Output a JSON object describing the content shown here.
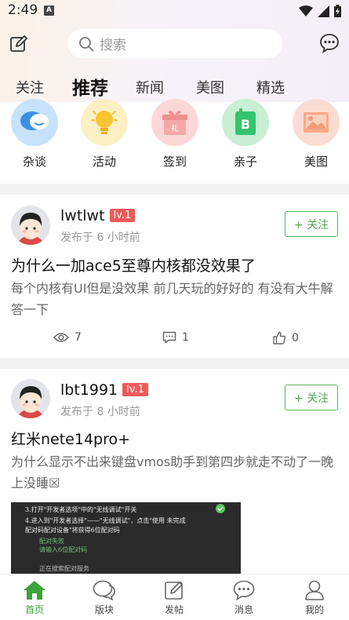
{
  "status_bar": {
    "time": "2:49",
    "notif_letter": "A"
  },
  "header": {
    "search_placeholder": "搜索",
    "tabs": [
      {
        "label": "关注"
      },
      {
        "label": "推荐"
      },
      {
        "label": "新闻"
      },
      {
        "label": "美图"
      },
      {
        "label": "精选"
      }
    ],
    "active_tab": "推荐"
  },
  "categories": [
    {
      "label": "杂谈",
      "icon": "chat-bubble-icon",
      "color": "#c6e3fb"
    },
    {
      "label": "活动",
      "icon": "lightbulb-icon",
      "color": "#fbf0c4"
    },
    {
      "label": "签到",
      "icon": "gift-icon",
      "color": "#fbd7d7"
    },
    {
      "label": "亲子",
      "icon": "book-icon",
      "color": "#c8efd3"
    },
    {
      "label": "美图",
      "icon": "picture-icon",
      "color": "#fbdcd2"
    }
  ],
  "posts": [
    {
      "username": "lwtlwt",
      "level": "lv.1",
      "time": "发布于 6 小时前",
      "follow_label": "+ 关注",
      "title": "为什么一加ace5至尊内核都没效果了",
      "body": "每个内核有UI但是没效果 前几天玩的好好的 有没有大牛解答一下",
      "views": "7",
      "comments": "1",
      "likes": "0"
    },
    {
      "username": "lbt1991",
      "level": "lv.1",
      "time": "发布于 8 小时前",
      "follow_label": "+ 关注",
      "title": "红米nete14pro+",
      "body": "为什么显示不出来键盘vmos助手到第四步就走不动了一晚上没睡☒",
      "image_lines": [
        "3.打开\"开发者选项\"中的\"无线调试\"开关",
        "4.进入到\"开发者选择\"——\"无线调试\"，点击\"使用   未完成",
        "配对码配对设备\"将获得6位配对码",
        "配对失败",
        "请输入6位配对码",
        "正在搜索配对服务"
      ]
    }
  ],
  "bottom_nav": [
    {
      "label": "首页",
      "icon": "home-icon",
      "active": true
    },
    {
      "label": "版块",
      "icon": "forum-icon",
      "active": false
    },
    {
      "label": "发帖",
      "icon": "compose-icon",
      "active": false
    },
    {
      "label": "消息",
      "icon": "message-icon",
      "active": false
    },
    {
      "label": "我的",
      "icon": "user-icon",
      "active": false
    }
  ],
  "colors": {
    "accent_green": "#3aa43c",
    "level_red": "#f05a5a"
  }
}
